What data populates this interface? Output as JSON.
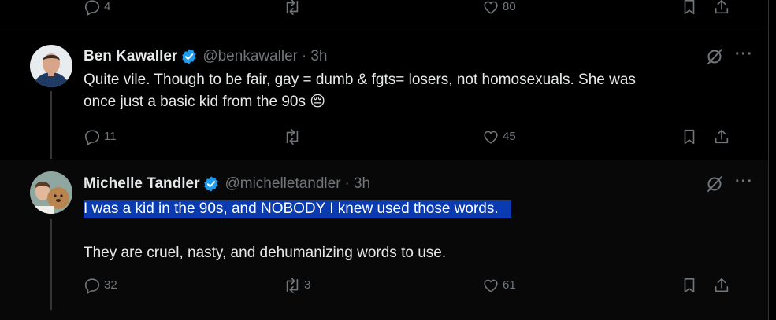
{
  "prev_tweet": {
    "reply_count": "4",
    "retweet_count": "",
    "like_count": "80"
  },
  "tweets": [
    {
      "name": "Ben Kawaller",
      "handle": "@benkawaller",
      "separator": "·",
      "time": "3h",
      "lines": [
        "Quite vile. Though to be fair, gay = dumb & fgts= losers, not homosexuals. She was",
        "once just a basic kid from the 90s 😔"
      ],
      "reply_count": "11",
      "retweet_count": "",
      "like_count": "45"
    },
    {
      "name": "Michelle Tandler",
      "handle": "@michelletandler",
      "separator": "·",
      "time": "3h",
      "highlighted_line": "I was a kid in the 90s, and NOBODY I knew used those words.",
      "second_para": "They are cruel, nasty, and dehumanizing words to use.",
      "reply_count": "32",
      "retweet_count": "3",
      "like_count": "61"
    }
  ],
  "icons": {
    "reply": "reply-icon",
    "retweet": "retweet-icon",
    "like": "like-icon",
    "bookmark": "bookmark-icon",
    "share": "share-icon",
    "grok": "grok-icon",
    "more": "more-icon",
    "verified": "verified-badge-icon"
  },
  "colors": {
    "background": "#000000",
    "text": "#e7e9ea",
    "muted": "#71767b",
    "verified": "#1d9bf0",
    "selection": "#0b3bb0"
  }
}
